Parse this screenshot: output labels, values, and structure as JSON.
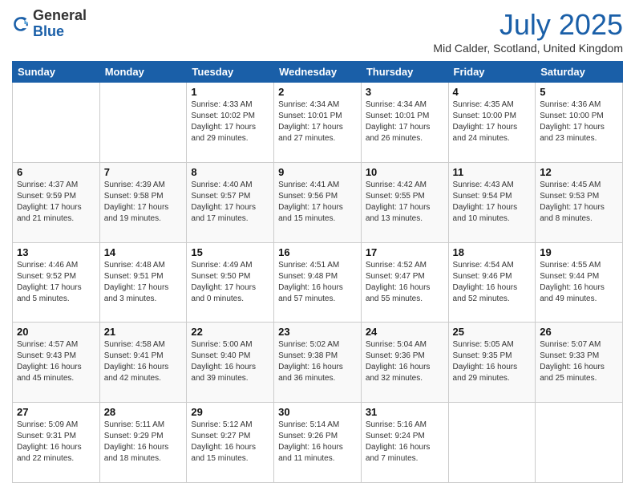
{
  "header": {
    "logo_general": "General",
    "logo_blue": "Blue",
    "month_title": "July 2025",
    "location": "Mid Calder, Scotland, United Kingdom"
  },
  "days_of_week": [
    "Sunday",
    "Monday",
    "Tuesday",
    "Wednesday",
    "Thursday",
    "Friday",
    "Saturday"
  ],
  "weeks": [
    [
      {
        "day": "",
        "info": ""
      },
      {
        "day": "",
        "info": ""
      },
      {
        "day": "1",
        "info": "Sunrise: 4:33 AM\nSunset: 10:02 PM\nDaylight: 17 hours and 29 minutes."
      },
      {
        "day": "2",
        "info": "Sunrise: 4:34 AM\nSunset: 10:01 PM\nDaylight: 17 hours and 27 minutes."
      },
      {
        "day": "3",
        "info": "Sunrise: 4:34 AM\nSunset: 10:01 PM\nDaylight: 17 hours and 26 minutes."
      },
      {
        "day": "4",
        "info": "Sunrise: 4:35 AM\nSunset: 10:00 PM\nDaylight: 17 hours and 24 minutes."
      },
      {
        "day": "5",
        "info": "Sunrise: 4:36 AM\nSunset: 10:00 PM\nDaylight: 17 hours and 23 minutes."
      }
    ],
    [
      {
        "day": "6",
        "info": "Sunrise: 4:37 AM\nSunset: 9:59 PM\nDaylight: 17 hours and 21 minutes."
      },
      {
        "day": "7",
        "info": "Sunrise: 4:39 AM\nSunset: 9:58 PM\nDaylight: 17 hours and 19 minutes."
      },
      {
        "day": "8",
        "info": "Sunrise: 4:40 AM\nSunset: 9:57 PM\nDaylight: 17 hours and 17 minutes."
      },
      {
        "day": "9",
        "info": "Sunrise: 4:41 AM\nSunset: 9:56 PM\nDaylight: 17 hours and 15 minutes."
      },
      {
        "day": "10",
        "info": "Sunrise: 4:42 AM\nSunset: 9:55 PM\nDaylight: 17 hours and 13 minutes."
      },
      {
        "day": "11",
        "info": "Sunrise: 4:43 AM\nSunset: 9:54 PM\nDaylight: 17 hours and 10 minutes."
      },
      {
        "day": "12",
        "info": "Sunrise: 4:45 AM\nSunset: 9:53 PM\nDaylight: 17 hours and 8 minutes."
      }
    ],
    [
      {
        "day": "13",
        "info": "Sunrise: 4:46 AM\nSunset: 9:52 PM\nDaylight: 17 hours and 5 minutes."
      },
      {
        "day": "14",
        "info": "Sunrise: 4:48 AM\nSunset: 9:51 PM\nDaylight: 17 hours and 3 minutes."
      },
      {
        "day": "15",
        "info": "Sunrise: 4:49 AM\nSunset: 9:50 PM\nDaylight: 17 hours and 0 minutes."
      },
      {
        "day": "16",
        "info": "Sunrise: 4:51 AM\nSunset: 9:48 PM\nDaylight: 16 hours and 57 minutes."
      },
      {
        "day": "17",
        "info": "Sunrise: 4:52 AM\nSunset: 9:47 PM\nDaylight: 16 hours and 55 minutes."
      },
      {
        "day": "18",
        "info": "Sunrise: 4:54 AM\nSunset: 9:46 PM\nDaylight: 16 hours and 52 minutes."
      },
      {
        "day": "19",
        "info": "Sunrise: 4:55 AM\nSunset: 9:44 PM\nDaylight: 16 hours and 49 minutes."
      }
    ],
    [
      {
        "day": "20",
        "info": "Sunrise: 4:57 AM\nSunset: 9:43 PM\nDaylight: 16 hours and 45 minutes."
      },
      {
        "day": "21",
        "info": "Sunrise: 4:58 AM\nSunset: 9:41 PM\nDaylight: 16 hours and 42 minutes."
      },
      {
        "day": "22",
        "info": "Sunrise: 5:00 AM\nSunset: 9:40 PM\nDaylight: 16 hours and 39 minutes."
      },
      {
        "day": "23",
        "info": "Sunrise: 5:02 AM\nSunset: 9:38 PM\nDaylight: 16 hours and 36 minutes."
      },
      {
        "day": "24",
        "info": "Sunrise: 5:04 AM\nSunset: 9:36 PM\nDaylight: 16 hours and 32 minutes."
      },
      {
        "day": "25",
        "info": "Sunrise: 5:05 AM\nSunset: 9:35 PM\nDaylight: 16 hours and 29 minutes."
      },
      {
        "day": "26",
        "info": "Sunrise: 5:07 AM\nSunset: 9:33 PM\nDaylight: 16 hours and 25 minutes."
      }
    ],
    [
      {
        "day": "27",
        "info": "Sunrise: 5:09 AM\nSunset: 9:31 PM\nDaylight: 16 hours and 22 minutes."
      },
      {
        "day": "28",
        "info": "Sunrise: 5:11 AM\nSunset: 9:29 PM\nDaylight: 16 hours and 18 minutes."
      },
      {
        "day": "29",
        "info": "Sunrise: 5:12 AM\nSunset: 9:27 PM\nDaylight: 16 hours and 15 minutes."
      },
      {
        "day": "30",
        "info": "Sunrise: 5:14 AM\nSunset: 9:26 PM\nDaylight: 16 hours and 11 minutes."
      },
      {
        "day": "31",
        "info": "Sunrise: 5:16 AM\nSunset: 9:24 PM\nDaylight: 16 hours and 7 minutes."
      },
      {
        "day": "",
        "info": ""
      },
      {
        "day": "",
        "info": ""
      }
    ]
  ]
}
